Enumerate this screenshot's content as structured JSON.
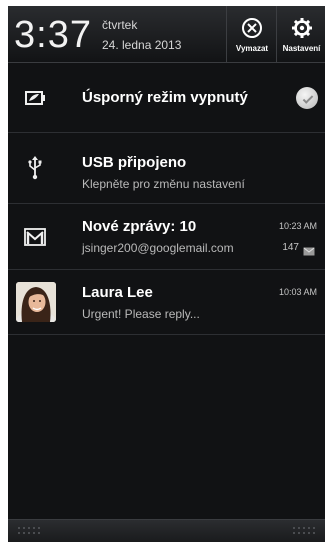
{
  "status": {
    "time": "3:37",
    "weekday": "čtvrtek",
    "date": "24. ledna 2013"
  },
  "actions": {
    "clear_label": "Vymazat",
    "settings_label": "Nastavení"
  },
  "notifications": [
    {
      "icon": "battery-saver-icon",
      "title": "Úsporný režim vypnutý",
      "toggle": "off"
    },
    {
      "icon": "usb-icon",
      "title": "USB připojeno",
      "subtitle": "Klepněte pro změnu nastavení"
    },
    {
      "icon": "gmail-icon",
      "title": "Nové zprávy: 10",
      "subtitle": "jsinger200@googlemail.com",
      "time": "10:23 AM",
      "count": "147"
    },
    {
      "icon": "avatar",
      "title": "Laura Lee",
      "subtitle": "Urgent! Please reply...",
      "time": "10:03 AM"
    }
  ],
  "colors": {
    "panel_background": "#111214",
    "title_text": "#ffffff",
    "subtitle_text": "#b9b9b9"
  }
}
